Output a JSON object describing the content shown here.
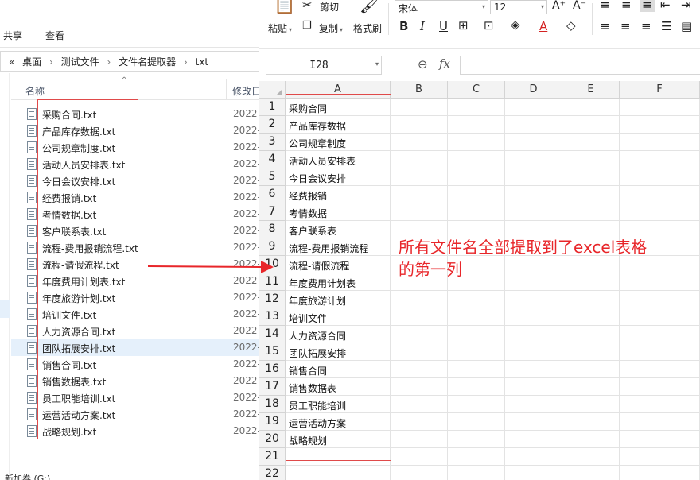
{
  "explorer": {
    "ribbon_tabs": [
      "共享",
      "查看"
    ],
    "breadcrumb": [
      "«",
      "桌面",
      "测试文件",
      "文件名提取器",
      "txt"
    ],
    "columns": {
      "name": "名称",
      "modified": "修改日"
    },
    "files": [
      {
        "name": "采购合同.txt",
        "date": "2022-"
      },
      {
        "name": "产品库存数据.txt",
        "date": "2022-"
      },
      {
        "name": "公司规章制度.txt",
        "date": "2022-"
      },
      {
        "name": "活动人员安排表.txt",
        "date": "2022-"
      },
      {
        "name": "今日会议安排.txt",
        "date": "2022-"
      },
      {
        "name": "经费报销.txt",
        "date": "2022-"
      },
      {
        "name": "考情数据.txt",
        "date": "2022-"
      },
      {
        "name": "客户联系表.txt",
        "date": "2022-"
      },
      {
        "name": "流程-费用报销流程.txt",
        "date": "2022-"
      },
      {
        "name": "流程-请假流程.txt",
        "date": "2022-"
      },
      {
        "name": "年度费用计划表.txt",
        "date": "2022-"
      },
      {
        "name": "年度旅游计划.txt",
        "date": "2022-"
      },
      {
        "name": "培训文件.txt",
        "date": "2022-"
      },
      {
        "name": "人力资源合同.txt",
        "date": "2022-"
      },
      {
        "name": "团队拓展安排.txt",
        "date": "2022-"
      },
      {
        "name": "销售合同.txt",
        "date": "2022-"
      },
      {
        "name": "销售数据表.txt",
        "date": "2022-"
      },
      {
        "name": "员工职能培训.txt",
        "date": "2022-"
      },
      {
        "name": "运营活动方案.txt",
        "date": "2022-"
      },
      {
        "name": "战略规划.txt",
        "date": "2022-"
      }
    ],
    "selected_file_index": 14,
    "drive_label": "新加卷 (G:)"
  },
  "toolbar": {
    "paste": "粘贴",
    "cut": "剪切",
    "copy": "复制",
    "format_painter": "格式刷",
    "font_name": "宋体",
    "font_size": "12"
  },
  "formula_bar": {
    "cell_ref": "I28",
    "fx": "fx",
    "value": ""
  },
  "sheet": {
    "columns": [
      "A",
      "B",
      "C",
      "D",
      "E",
      "F"
    ],
    "rows": [
      "1",
      "2",
      "3",
      "4",
      "5",
      "6",
      "7",
      "8",
      "9",
      "10",
      "11",
      "12",
      "13",
      "14",
      "15",
      "16",
      "17",
      "18",
      "19",
      "20",
      "21",
      "22"
    ],
    "column_a": [
      "采购合同",
      "产品库存数据",
      "公司规章制度",
      "活动人员安排表",
      "今日会议安排",
      "经费报销",
      "考情数据",
      "客户联系表",
      "流程-费用报销流程",
      "流程-请假流程",
      "年度费用计划表",
      "年度旅游计划",
      "培训文件",
      "人力资源合同",
      "团队拓展安排",
      "销售合同",
      "销售数据表",
      "员工职能培训",
      "运营活动方案",
      "战略规划",
      "",
      ""
    ]
  },
  "annotation": {
    "line1": "所有文件名全部提取到了excel表格",
    "line2": "的第一列",
    "color": "#e8262a"
  },
  "colors": {
    "highlight_box": "#e04a4a",
    "selection": "#e5f0fb"
  }
}
